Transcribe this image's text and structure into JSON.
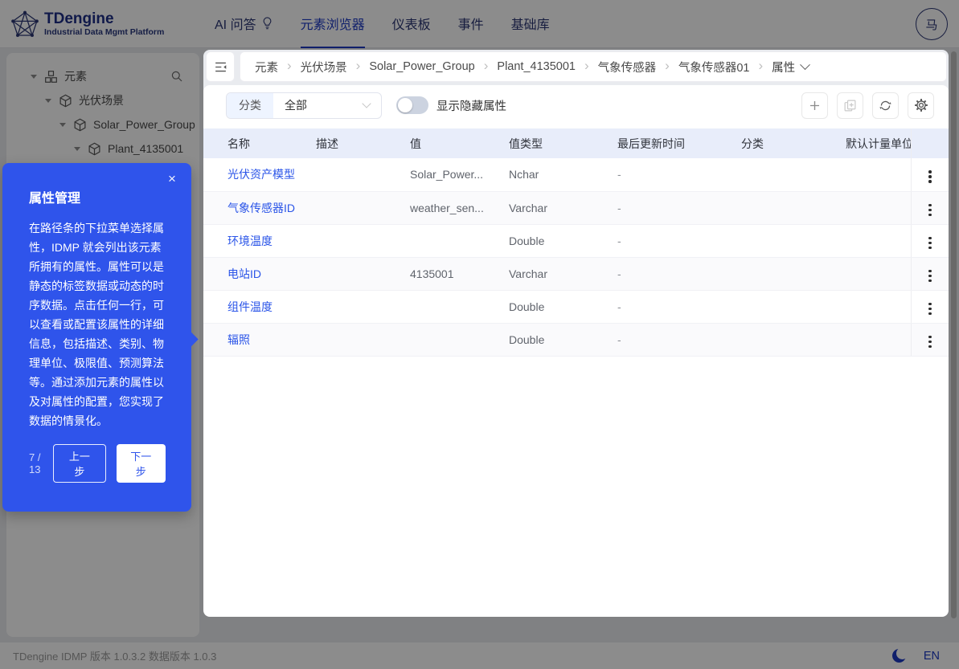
{
  "topbar": {
    "logo_title": "TDengine",
    "logo_subtitle": "Industrial Data Mgmt Platform",
    "nav": [
      {
        "label": "AI 问答"
      },
      {
        "label": "元素浏览器"
      },
      {
        "label": "仪表板"
      },
      {
        "label": "事件"
      },
      {
        "label": "基础库"
      }
    ],
    "avatar_text": "马"
  },
  "sidebar": {
    "tree": [
      {
        "label": "元素"
      },
      {
        "label": "光伏场景"
      },
      {
        "label": "Solar_Power_Group"
      },
      {
        "label": "Plant_4135001"
      }
    ]
  },
  "breadcrumb": {
    "items": [
      "元素",
      "光伏场景",
      "Solar_Power_Group",
      "Plant_4135001",
      "气象传感器",
      "气象传感器01"
    ],
    "current": "属性"
  },
  "filter": {
    "category_label": "分类",
    "category_value": "全部",
    "toggle_label": "显示隐藏属性",
    "toggle_on": false
  },
  "table": {
    "headers": [
      "名称",
      "描述",
      "值",
      "值类型",
      "最后更新时间",
      "分类",
      "默认计量单位"
    ],
    "rows": [
      {
        "name": "光伏资产模型",
        "desc": "",
        "value": "Solar_Power...",
        "type": "Nchar",
        "updated": "-",
        "category": "",
        "unit": ""
      },
      {
        "name": "气象传感器ID",
        "desc": "",
        "value": "weather_sen...",
        "type": "Varchar",
        "updated": "-",
        "category": "",
        "unit": ""
      },
      {
        "name": "环境温度",
        "desc": "",
        "value": "",
        "type": "Double",
        "updated": "-",
        "category": "",
        "unit": ""
      },
      {
        "name": "电站ID",
        "desc": "",
        "value": "4135001",
        "type": "Varchar",
        "updated": "-",
        "category": "",
        "unit": ""
      },
      {
        "name": "组件温度",
        "desc": "",
        "value": "",
        "type": "Double",
        "updated": "-",
        "category": "",
        "unit": ""
      },
      {
        "name": "辐照",
        "desc": "",
        "value": "",
        "type": "Double",
        "updated": "-",
        "category": "",
        "unit": ""
      }
    ]
  },
  "tour": {
    "title": "属性管理",
    "description": "在路径条的下拉菜单选择属性，IDMP 就会列出该元素所拥有的属性。属性可以是静态的标签数据或动态的时序数据。点击任何一行，可以查看或配置该属性的详细信息，包括描述、类别、物理单位、极限值、预测算法等。通过添加元素的属性以及对属性的配置，您实现了数据的情景化。",
    "step": "7 / 13",
    "prev_label": "上一步",
    "next_label": "下一步",
    "close": "×"
  },
  "footer": {
    "version_text": "TDengine IDMP 版本 1.0.3.2 数据版本 1.0.3",
    "lang": "EN"
  },
  "colors": {
    "accent": "#1d39c4",
    "link": "#2b55e8",
    "tour_background": "#2f54eb",
    "table_header_background": "#e8edfa",
    "mask": "rgba(0,0,0,0.45)"
  }
}
